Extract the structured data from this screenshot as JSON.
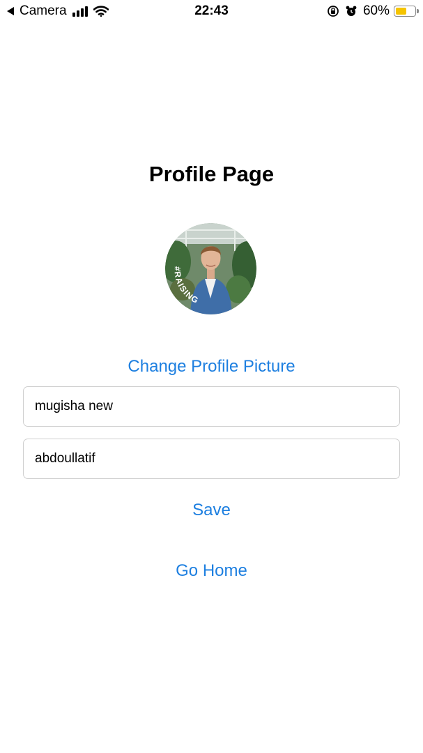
{
  "status_bar": {
    "back_label": "Camera",
    "time": "22:43",
    "battery_percent": "60%",
    "battery_level": 0.6,
    "battery_color": "#f5c400"
  },
  "page": {
    "title": "Profile Page",
    "avatar_badge": "#RAISING",
    "change_picture_label": "Change Profile Picture",
    "first_field_value": "mugisha new",
    "second_field_value": "abdoullatif",
    "save_label": "Save",
    "go_home_label": "Go Home",
    "accent_color": "#1d7fe0"
  }
}
